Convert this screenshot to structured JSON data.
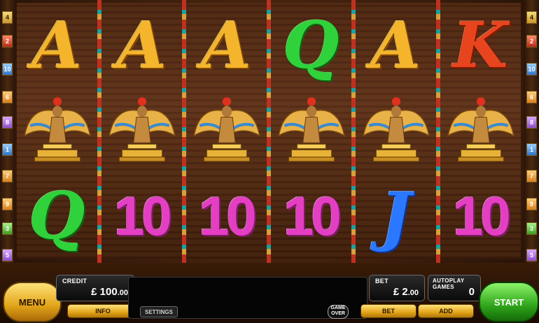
{
  "paylines": {
    "left": [
      "4",
      "2",
      "10",
      "6",
      "8",
      "1",
      "7",
      "9",
      "3",
      "5"
    ],
    "right": [
      "4",
      "2",
      "10",
      "6",
      "8",
      "1",
      "7",
      "9",
      "3",
      "5"
    ]
  },
  "reels": [
    [
      "A",
      "goddess",
      "Q"
    ],
    [
      "A",
      "goddess",
      "10"
    ],
    [
      "A",
      "goddess",
      "10"
    ],
    [
      "Q",
      "goddess",
      "10"
    ],
    [
      "A",
      "goddess",
      "J"
    ],
    [
      "K",
      "goddess",
      "10"
    ]
  ],
  "controls": {
    "menu_label": "MENU",
    "credit_label": "CREDIT",
    "credit_currency": "£",
    "credit_whole": "100",
    "credit_pence": "00",
    "info_label": "INFO",
    "settings_label": "SETTINGS",
    "game_over_line1": "GAME",
    "game_over_line2": "OVER",
    "bet_label": "BET",
    "bet_currency": "£",
    "bet_whole": "2",
    "bet_pence": "00",
    "bet_button_label": "BET",
    "autoplay_label": "AUTOPLAY GAMES",
    "autoplay_value": "0",
    "add_label": "ADD",
    "start_label": "START"
  },
  "colors": {
    "A": "#f4b52c",
    "K": "#e8441e",
    "Q": "#2fd23a",
    "J": "#2a78ff",
    "10": "#e43ec2"
  }
}
